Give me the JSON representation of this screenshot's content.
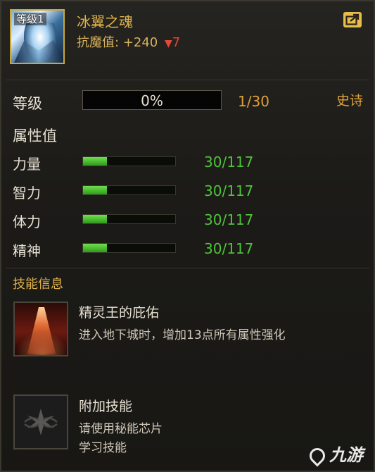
{
  "item": {
    "level_tag": "等级1",
    "title": "冰翼之魂",
    "resist_label": "抗魔值:",
    "resist_value": "+240",
    "resist_delta": "7",
    "delta_symbol": "▼"
  },
  "level": {
    "label": "等级",
    "percent_text": "0%",
    "progress": 0.0,
    "count": "1/30",
    "grade": "史诗"
  },
  "attributes": {
    "heading": "属性值",
    "rows": [
      {
        "label": "力量",
        "value": "30/117",
        "progress": 0.256
      },
      {
        "label": "智力",
        "value": "30/117",
        "progress": 0.256
      },
      {
        "label": "体力",
        "value": "30/117",
        "progress": 0.256
      },
      {
        "label": "精神",
        "value": "30/117",
        "progress": 0.256
      }
    ]
  },
  "skills": {
    "heading": "技能信息",
    "items": [
      {
        "name": "精灵王的庇佑",
        "desc": [
          "进入地下城时，增加13点所有属性强化"
        ],
        "icon": "elf-king-blessing-icon"
      },
      {
        "name": "附加技能",
        "desc": [
          "请使用秘能芯片",
          "学习技能"
        ],
        "icon": "locked-skill-icon"
      }
    ]
  },
  "watermark": "九游",
  "colors": {
    "gold": "#e0b24a",
    "orange": "#e0a13a",
    "green": "#4ec43a",
    "red": "#e04a36"
  }
}
